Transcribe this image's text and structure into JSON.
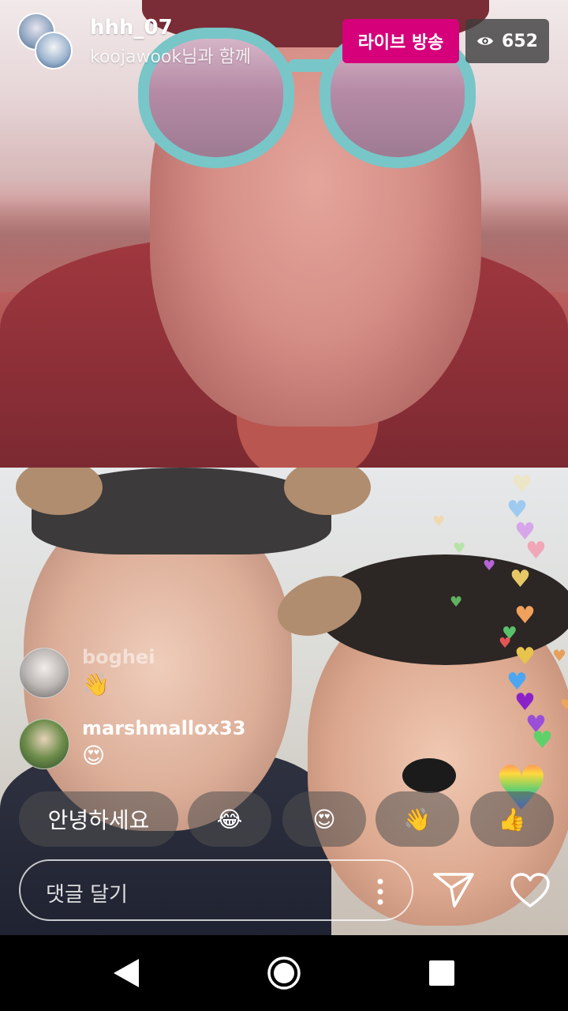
{
  "header": {
    "host_username": "hhh_07",
    "guest_line": "koojawook님과 함께",
    "live_label": "라이브 방송",
    "viewer_count": "652",
    "viewer_icon": "eye-icon",
    "live_color": "#d6007a"
  },
  "comments": [
    {
      "username": "boghei",
      "text": "👋",
      "faded": true
    },
    {
      "username": "marshmallox33",
      "text": "😍",
      "faded": false
    }
  ],
  "quick_replies": [
    "안녕하세요",
    "😂",
    "😍",
    "👋",
    "👍"
  ],
  "composer": {
    "placeholder": "댓글 달기",
    "more_icon": "more-vertical-icon",
    "send_icon": "send-icon",
    "like_icon": "heart-outline-icon"
  },
  "nav": {
    "back_icon": "back-triangle-icon",
    "home_icon": "home-circle-icon",
    "recent_icon": "recent-square-icon"
  }
}
